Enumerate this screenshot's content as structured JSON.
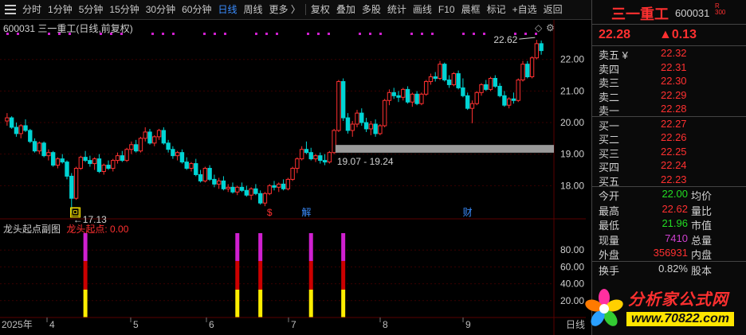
{
  "toolbar": {
    "periods": [
      "分时",
      "1分钟",
      "5分钟",
      "15分钟",
      "30分钟",
      "60分钟",
      "日线",
      "周线",
      "更多 〉"
    ],
    "active_period": "日线",
    "tools": [
      "复权",
      "叠加",
      "多股",
      "统计",
      "画线",
      "F10",
      "标记",
      "+自选",
      "返回"
    ],
    "morning_star": "晨框"
  },
  "chart": {
    "title": "600031 三一重工(日线,前复权)",
    "high_label": "22.62",
    "low_label": "←17.13",
    "range_label": "19.07 - 19.24",
    "y_ticks": [
      "22.00",
      "21.00",
      "20.00",
      "19.00",
      "18.00"
    ],
    "event_marks": [
      "回",
      "$",
      "解",
      "财"
    ],
    "x_labels": [
      "2025年",
      "4",
      "5",
      "6",
      "7",
      "8",
      "9",
      "日线"
    ],
    "sub_name": "龙头起点副图",
    "sub_value": "龙头起点: 0.00",
    "sub_ticks": [
      "80.00",
      "60.00",
      "40.00",
      "20.00"
    ]
  },
  "chart_data": {
    "type": "candlestick",
    "y_range": [
      17.0,
      22.9
    ],
    "y_ticks": [
      18,
      19,
      20,
      21,
      22
    ],
    "support_band": [
      19.07,
      19.24
    ],
    "highest": 22.62,
    "lowest": 17.13,
    "sub_indicator": {
      "name": "龙头起点",
      "value": 0.0,
      "y_range": [
        0,
        100
      ],
      "signals": [
        {
          "index": 17,
          "value": 100
        },
        {
          "index": 50,
          "value": 100
        },
        {
          "index": 55,
          "value": 100
        },
        {
          "index": 66,
          "value": 100
        },
        {
          "index": 73,
          "value": 100
        }
      ]
    },
    "ohlc": [
      [
        20.05,
        20.3,
        19.9,
        20.15
      ],
      [
        20.15,
        20.2,
        19.8,
        19.85
      ],
      [
        19.85,
        20.0,
        19.55,
        19.65
      ],
      [
        19.65,
        19.95,
        19.5,
        19.9
      ],
      [
        19.9,
        20.1,
        19.7,
        19.75
      ],
      [
        19.75,
        19.8,
        19.35,
        19.4
      ],
      [
        19.4,
        19.5,
        19.05,
        19.1
      ],
      [
        19.1,
        19.4,
        19.0,
        19.35
      ],
      [
        19.35,
        19.4,
        18.9,
        18.95
      ],
      [
        18.95,
        19.15,
        18.8,
        19.05
      ],
      [
        19.05,
        19.1,
        18.6,
        18.65
      ],
      [
        18.65,
        18.9,
        18.55,
        18.85
      ],
      [
        18.85,
        19.0,
        18.7,
        18.75
      ],
      [
        18.75,
        18.8,
        18.2,
        18.3
      ],
      [
        18.3,
        18.4,
        17.13,
        17.6
      ],
      [
        17.6,
        18.6,
        17.55,
        18.55
      ],
      [
        18.55,
        18.95,
        18.5,
        18.9
      ],
      [
        18.9,
        19.1,
        18.75,
        18.8
      ],
      [
        18.8,
        18.95,
        18.6,
        18.7
      ],
      [
        18.7,
        18.9,
        18.5,
        18.85
      ],
      [
        18.85,
        19.0,
        18.4,
        18.45
      ],
      [
        18.45,
        18.7,
        18.35,
        18.65
      ],
      [
        18.65,
        18.8,
        18.5,
        18.55
      ],
      [
        18.55,
        18.85,
        18.45,
        18.8
      ],
      [
        18.8,
        19.05,
        18.7,
        18.95
      ],
      [
        18.95,
        19.1,
        18.75,
        18.8
      ],
      [
        18.8,
        19.2,
        18.75,
        19.15
      ],
      [
        19.15,
        19.4,
        19.0,
        19.3
      ],
      [
        19.3,
        19.45,
        19.05,
        19.1
      ],
      [
        19.1,
        19.55,
        19.05,
        19.5
      ],
      [
        19.5,
        19.85,
        19.4,
        19.7
      ],
      [
        19.7,
        19.8,
        19.3,
        19.35
      ],
      [
        19.35,
        19.6,
        19.25,
        19.55
      ],
      [
        19.55,
        19.8,
        19.45,
        19.75
      ],
      [
        19.75,
        19.85,
        19.3,
        19.35
      ],
      [
        19.35,
        19.45,
        19.05,
        19.15
      ],
      [
        19.15,
        19.25,
        18.85,
        18.95
      ],
      [
        18.95,
        19.1,
        18.8,
        19.05
      ],
      [
        19.05,
        19.15,
        18.7,
        18.75
      ],
      [
        18.75,
        18.9,
        18.5,
        18.55
      ],
      [
        18.55,
        18.75,
        18.45,
        18.7
      ],
      [
        18.7,
        18.85,
        18.3,
        18.35
      ],
      [
        18.35,
        18.5,
        18.1,
        18.15
      ],
      [
        18.15,
        18.6,
        18.1,
        18.55
      ],
      [
        18.55,
        18.65,
        18.15,
        18.2
      ],
      [
        18.2,
        18.35,
        17.95,
        18.05
      ],
      [
        18.05,
        18.25,
        17.9,
        18.15
      ],
      [
        18.15,
        18.3,
        17.85,
        17.9
      ],
      [
        17.9,
        18.05,
        17.8,
        17.95
      ],
      [
        17.95,
        18.1,
        17.75,
        17.8
      ],
      [
        17.8,
        18.0,
        17.7,
        17.95
      ],
      [
        17.95,
        18.1,
        17.8,
        17.85
      ],
      [
        17.85,
        18.0,
        17.65,
        17.7
      ],
      [
        17.7,
        17.95,
        17.55,
        17.9
      ],
      [
        17.9,
        18.05,
        17.7,
        17.75
      ],
      [
        17.75,
        17.85,
        17.4,
        17.45
      ],
      [
        17.45,
        17.8,
        17.35,
        17.75
      ],
      [
        17.75,
        18.05,
        17.7,
        18.0
      ],
      [
        18.0,
        18.15,
        17.85,
        17.95
      ],
      [
        17.95,
        18.1,
        17.8,
        18.05
      ],
      [
        18.05,
        18.2,
        17.85,
        17.9
      ],
      [
        17.9,
        18.25,
        17.85,
        18.2
      ],
      [
        18.2,
        18.6,
        18.15,
        18.55
      ],
      [
        18.55,
        18.9,
        18.4,
        18.85
      ],
      [
        18.85,
        19.25,
        18.8,
        19.15
      ],
      [
        19.15,
        19.4,
        19.0,
        19.05
      ],
      [
        19.05,
        19.2,
        18.8,
        18.85
      ],
      [
        18.85,
        19.0,
        18.75,
        18.95
      ],
      [
        18.95,
        19.05,
        18.7,
        18.8
      ],
      [
        18.8,
        19.0,
        18.65,
        18.75
      ],
      [
        18.75,
        19.1,
        18.7,
        19.05
      ],
      [
        19.05,
        19.8,
        19.0,
        19.75
      ],
      [
        19.75,
        21.35,
        19.7,
        21.3
      ],
      [
        21.3,
        21.4,
        20.05,
        20.15
      ],
      [
        20.15,
        20.3,
        19.65,
        19.75
      ],
      [
        19.75,
        20.05,
        19.55,
        19.95
      ],
      [
        19.95,
        20.4,
        19.85,
        20.3
      ],
      [
        20.3,
        20.45,
        19.9,
        20.0
      ],
      [
        20.0,
        20.15,
        19.7,
        19.8
      ],
      [
        19.8,
        20.05,
        19.6,
        19.95
      ],
      [
        19.95,
        20.1,
        19.55,
        19.65
      ],
      [
        19.65,
        19.95,
        19.6,
        19.9
      ],
      [
        19.9,
        20.75,
        19.85,
        20.7
      ],
      [
        20.7,
        21.05,
        20.55,
        20.95
      ],
      [
        20.95,
        21.1,
        20.75,
        20.85
      ],
      [
        20.85,
        21.0,
        20.65,
        20.8
      ],
      [
        20.8,
        21.1,
        20.7,
        21.05
      ],
      [
        21.05,
        21.15,
        20.6,
        20.65
      ],
      [
        20.65,
        20.95,
        20.5,
        20.9
      ],
      [
        20.9,
        21.0,
        20.55,
        20.6
      ],
      [
        20.6,
        20.95,
        20.55,
        20.9
      ],
      [
        20.9,
        21.35,
        20.85,
        21.3
      ],
      [
        21.3,
        21.55,
        21.2,
        21.45
      ],
      [
        21.45,
        21.6,
        21.3,
        21.4
      ],
      [
        21.4,
        21.95,
        21.35,
        21.85
      ],
      [
        21.85,
        21.9,
        21.3,
        21.35
      ],
      [
        21.35,
        21.5,
        21.1,
        21.2
      ],
      [
        21.2,
        21.6,
        21.15,
        21.55
      ],
      [
        21.55,
        21.65,
        21.05,
        21.1
      ],
      [
        21.1,
        21.4,
        20.8,
        20.85
      ],
      [
        20.85,
        20.95,
        20.4,
        20.45
      ],
      [
        20.45,
        20.7,
        19.98,
        20.6
      ],
      [
        20.6,
        21.0,
        20.55,
        20.95
      ],
      [
        20.95,
        21.25,
        20.85,
        21.2
      ],
      [
        21.2,
        21.35,
        21.0,
        21.05
      ],
      [
        21.05,
        21.45,
        21.0,
        21.4
      ],
      [
        21.4,
        21.5,
        21.1,
        21.15
      ],
      [
        21.15,
        21.25,
        20.8,
        20.85
      ],
      [
        20.85,
        21.0,
        20.5,
        20.55
      ],
      [
        20.55,
        20.8,
        20.45,
        20.75
      ],
      [
        20.75,
        20.95,
        20.6,
        20.7
      ],
      [
        20.7,
        21.4,
        20.65,
        21.35
      ],
      [
        21.35,
        21.95,
        21.3,
        21.85
      ],
      [
        21.85,
        21.95,
        21.4,
        21.45
      ],
      [
        21.45,
        22.1,
        21.4,
        22.05
      ],
      [
        22.05,
        22.62,
        22.0,
        22.5
      ],
      [
        22.5,
        22.6,
        22.15,
        22.28
      ]
    ]
  },
  "quote": {
    "name": "三一重工",
    "code": "600031",
    "badge_top": "R",
    "badge_bottom": "300",
    "last": "22.28",
    "change": "▲0.13"
  },
  "order_book": {
    "asks": [
      {
        "label": "卖五",
        "currency": "¥",
        "price": "22.32"
      },
      {
        "label": "卖四",
        "currency": "",
        "price": "22.31"
      },
      {
        "label": "卖三",
        "currency": "",
        "price": "22.30"
      },
      {
        "label": "卖二",
        "currency": "",
        "price": "22.29"
      },
      {
        "label": "卖一",
        "currency": "",
        "price": "22.28"
      }
    ],
    "bids": [
      {
        "label": "买一",
        "price": "22.27"
      },
      {
        "label": "买二",
        "price": "22.26"
      },
      {
        "label": "买三",
        "price": "22.25"
      },
      {
        "label": "买四",
        "price": "22.24"
      },
      {
        "label": "买五",
        "price": "22.23"
      }
    ]
  },
  "stats": [
    {
      "label": "今开",
      "value": "22.00",
      "label2": "均价",
      "color": "#22dd22"
    },
    {
      "label": "最高",
      "value": "22.62",
      "label2": "量比",
      "color": "#ff3030"
    },
    {
      "label": "最低",
      "value": "21.96",
      "label2": "市值",
      "color": "#22dd22"
    },
    {
      "label": "现量",
      "value": "7410",
      "label2": "总量",
      "color": "#d040d0"
    },
    {
      "label": "外盘",
      "value": "356931",
      "label2": "内盘",
      "color": "#ff3030"
    },
    {
      "label": "换手",
      "value": "0.82%",
      "label2": "股本",
      "color": "#d0d0d0"
    }
  ],
  "watermark": {
    "text": "分析家公式网",
    "url": "www.70822.com"
  },
  "colors": {
    "up": "#ff3030",
    "down": "#00d4d4",
    "grid": "#3a0000",
    "band": "#9a9a9a",
    "magenta": "#d020d0",
    "red": "#cc0000",
    "yellow": "#ffee00"
  }
}
